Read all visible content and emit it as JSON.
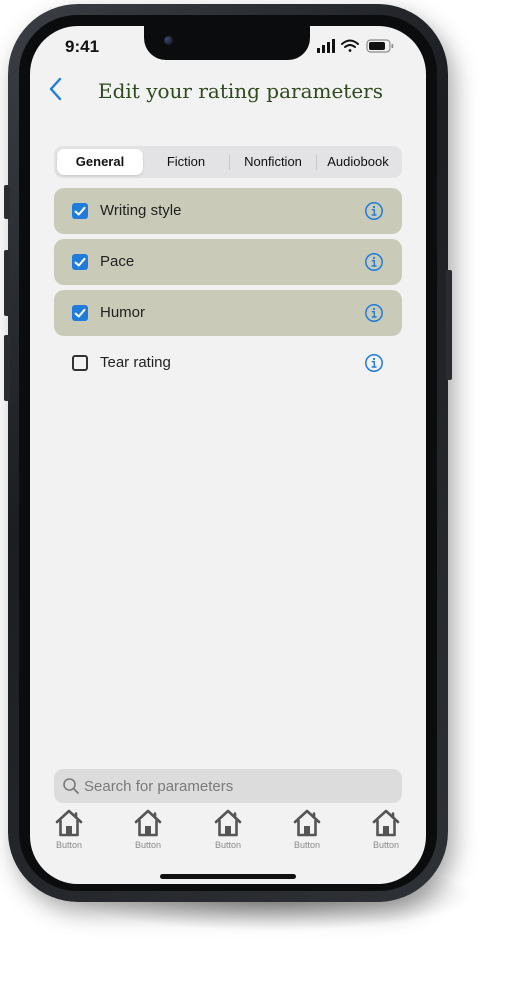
{
  "status_bar": {
    "time": "9:41"
  },
  "header": {
    "title": "Edit your rating parameters"
  },
  "segments": [
    {
      "label": "General",
      "active": true
    },
    {
      "label": "Fiction",
      "active": false
    },
    {
      "label": "Nonfiction",
      "active": false
    },
    {
      "label": "Audiobook",
      "active": false
    }
  ],
  "parameters": [
    {
      "label": "Writing style",
      "checked": true
    },
    {
      "label": "Pace",
      "checked": true
    },
    {
      "label": "Humor",
      "checked": true
    },
    {
      "label": "Tear rating",
      "checked": false
    }
  ],
  "search": {
    "placeholder": "Search for parameters"
  },
  "tabbar": {
    "items": [
      {
        "label": "Button",
        "icon": "home-icon"
      },
      {
        "label": "Button",
        "icon": "home-icon"
      },
      {
        "label": "Button",
        "icon": "home-icon"
      },
      {
        "label": "Button",
        "icon": "home-icon"
      },
      {
        "label": "Button",
        "icon": "home-icon"
      }
    ]
  },
  "colors": {
    "accent": "#1f7cdb",
    "checked_row": "#c9cbb8",
    "title": "#2f4a1c",
    "background": "#f2f2f2"
  }
}
